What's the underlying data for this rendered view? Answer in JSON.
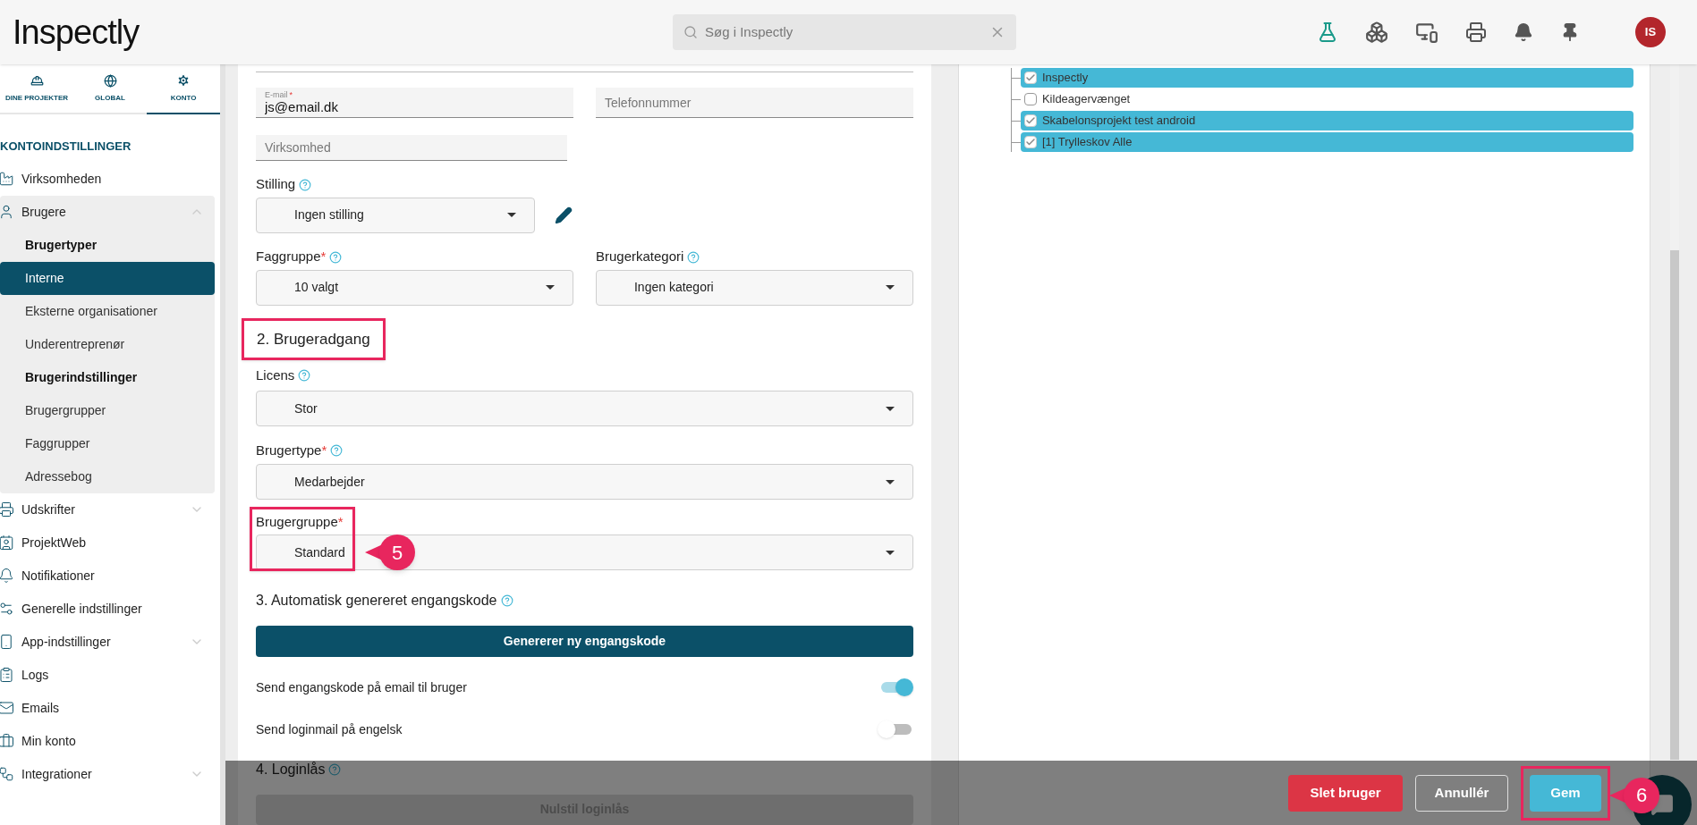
{
  "header": {
    "logo": "Inspectly",
    "search": {
      "placeholder": "Søg i Inspectly"
    },
    "avatar": "IS"
  },
  "sidebar": {
    "tabs": [
      {
        "label": "DINE PROJEKTER",
        "selected": false
      },
      {
        "label": "GLOBAL",
        "selected": false
      },
      {
        "label": "KONTO",
        "selected": true
      }
    ],
    "section_title": "KONTOINDSTILLINGER",
    "items": [
      {
        "label": "Virksomheden",
        "kind": "link",
        "selected": false
      },
      {
        "label": "Brugere",
        "kind": "group",
        "selected": false,
        "expanded": true,
        "children": [
          {
            "label": "Brugertyper",
            "kind": "heading"
          },
          {
            "label": "Interne",
            "kind": "link",
            "selected": true
          },
          {
            "label": "Eksterne organisationer",
            "kind": "link",
            "selected": false
          },
          {
            "label": "Underentreprenør",
            "kind": "link",
            "selected": false
          },
          {
            "label": "Brugerindstillinger",
            "kind": "heading"
          },
          {
            "label": "Brugergrupper",
            "kind": "link",
            "selected": false
          },
          {
            "label": "Faggrupper",
            "kind": "link",
            "selected": false
          },
          {
            "label": "Adressebog",
            "kind": "link",
            "selected": false
          }
        ]
      },
      {
        "label": "Udskrifter",
        "kind": "group",
        "selected": false,
        "expanded": false
      },
      {
        "label": "ProjektWeb",
        "kind": "link",
        "selected": false
      },
      {
        "label": "Notifikationer",
        "kind": "link",
        "selected": false
      },
      {
        "label": "Generelle indstillinger",
        "kind": "link",
        "selected": false
      },
      {
        "label": "App-indstillinger",
        "kind": "group",
        "selected": false,
        "expanded": false
      },
      {
        "label": "Logs",
        "kind": "link",
        "selected": false
      },
      {
        "label": "Emails",
        "kind": "link",
        "selected": false
      },
      {
        "label": "Min konto",
        "kind": "link",
        "selected": false
      },
      {
        "label": "Integrationer",
        "kind": "group",
        "selected": false,
        "expanded": false
      }
    ]
  },
  "form": {
    "email": {
      "label": "E-mail",
      "required_mark": "*",
      "value": "js@email.dk"
    },
    "phone": {
      "placeholder": "Telefonnummer"
    },
    "company": {
      "placeholder": "Virksomhed"
    },
    "position": {
      "label": "Stilling",
      "help": true,
      "value": "Ingen stilling"
    },
    "trade_group": {
      "label": "Faggruppe",
      "required_mark": "*",
      "help": true,
      "value": "10 valgt"
    },
    "user_category": {
      "label": "Brugerkategori",
      "help": true,
      "value": "Ingen kategori"
    },
    "section_2": {
      "title": "2. Brugeradgang",
      "highlight": true
    },
    "license": {
      "label": "Licens",
      "help": true,
      "value": "Stor"
    },
    "user_type": {
      "label": "Brugertype",
      "required_mark": "*",
      "help": true,
      "value": "Medarbejder"
    },
    "user_group": {
      "label": "Brugergruppe",
      "required_mark": "*",
      "value": "Standard",
      "highlight": true,
      "callout": "5"
    },
    "section_3": {
      "title": "3. Automatisk genereret engangskode",
      "help": true
    },
    "generate_button": "Genererer ny engangskode",
    "toggles": [
      {
        "label": "Send engangskode på email til bruger",
        "on": true
      },
      {
        "label": "Send loginmail på engelsk",
        "on": false
      }
    ],
    "section_4": {
      "title": "4. Loginlås",
      "help": true
    },
    "reset_button": "Nulstil loginlås"
  },
  "project_tree": [
    {
      "label": "Inspectly",
      "checked": true
    },
    {
      "label": "Kildeagervænget",
      "checked": false
    },
    {
      "label": "Skabelonsprojekt test android",
      "checked": true
    },
    {
      "label": "[1] Trylleskov Alle",
      "checked": true
    }
  ],
  "actions": [
    {
      "label": "Slet bruger",
      "kind": "danger",
      "highlight": false
    },
    {
      "label": "Annullér",
      "kind": "outline",
      "highlight": false
    },
    {
      "label": "Gem",
      "kind": "primary",
      "highlight": true,
      "callout": "6"
    }
  ]
}
